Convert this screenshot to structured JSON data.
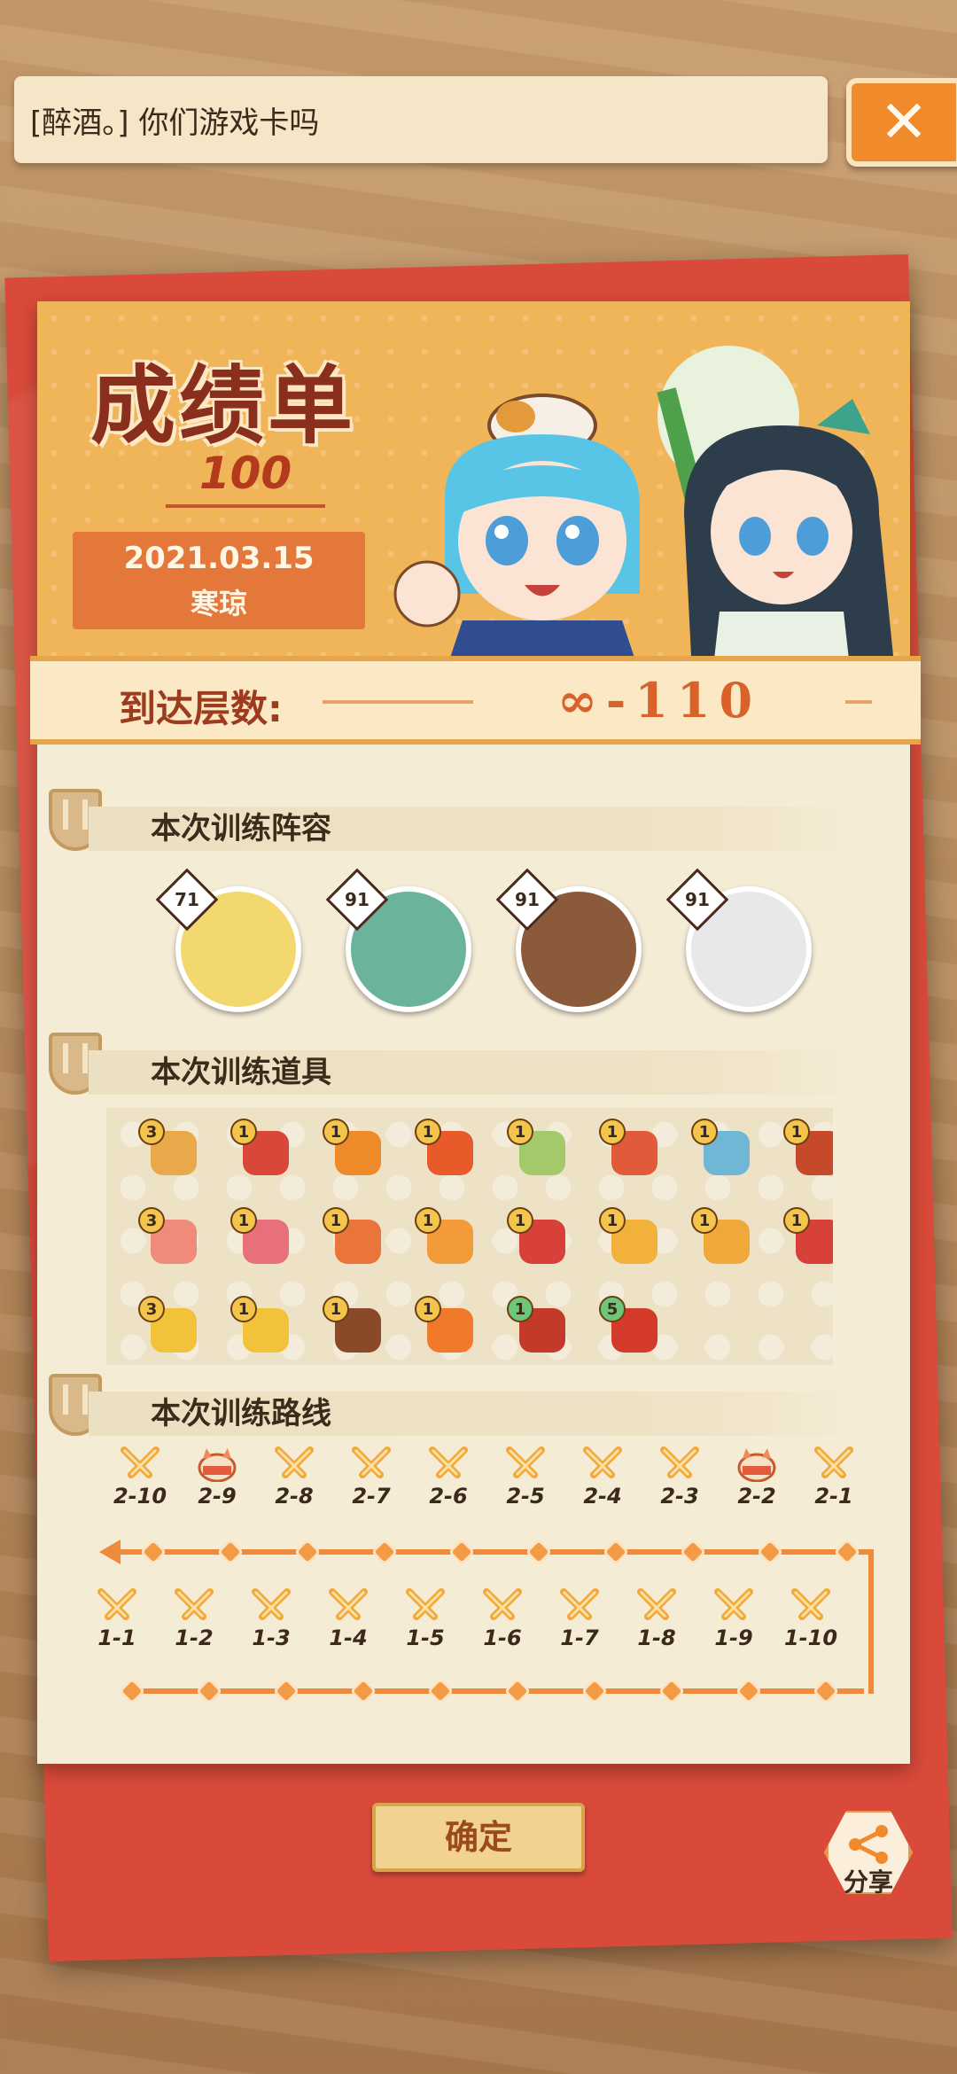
{
  "chat": {
    "message": "[醉酒。] 你们游戏卡吗"
  },
  "close": {
    "icon": "close-icon"
  },
  "report": {
    "title": "成绩单",
    "score": "100",
    "date": "2021.03.15",
    "player": "寒琼"
  },
  "floor": {
    "label": "到达层数:",
    "value": "∞-110"
  },
  "team": {
    "heading": "本次训练阵容",
    "members": [
      {
        "level": "71",
        "color": "#f3d870"
      },
      {
        "level": "91",
        "color": "#6bb39a"
      },
      {
        "level": "91",
        "color": "#8a5a3a"
      },
      {
        "level": "91",
        "color": "#e8e8ea"
      }
    ]
  },
  "items": {
    "heading": "本次训练道具",
    "rows": [
      [
        {
          "count": "3",
          "color": "#e9a84a"
        },
        {
          "count": "1",
          "color": "#d8473a"
        },
        {
          "count": "1",
          "color": "#ef8a2a"
        },
        {
          "count": "1",
          "color": "#e85a2a"
        },
        {
          "count": "1",
          "color": "#a4c96a"
        },
        {
          "count": "1",
          "color": "#e15a3a"
        },
        {
          "count": "1",
          "color": "#6fb7d4"
        },
        {
          "count": "1",
          "color": "#c64a2a"
        }
      ],
      [
        {
          "count": "3",
          "color": "#f08a7a"
        },
        {
          "count": "1",
          "color": "#e8707a"
        },
        {
          "count": "1",
          "color": "#e9753a"
        },
        {
          "count": "1",
          "color": "#f39a3a"
        },
        {
          "count": "1",
          "color": "#d8403a"
        },
        {
          "count": "1",
          "color": "#f2b13a"
        },
        {
          "count": "1",
          "color": "#f0a83a"
        },
        {
          "count": "1",
          "color": "#d8403a"
        }
      ],
      [
        {
          "count": "3",
          "color": "#f2c23a"
        },
        {
          "count": "1",
          "color": "#f2c23a"
        },
        {
          "count": "1",
          "color": "#8a4a2a"
        },
        {
          "count": "1",
          "color": "#f07a2a"
        },
        {
          "count": "1",
          "color": "#c43a2a",
          "green": true
        },
        {
          "count": "5",
          "color": "#d43a2a",
          "green": true
        }
      ]
    ]
  },
  "route": {
    "heading": "本次训练路线",
    "top": [
      "2-10",
      "2-9",
      "2-8",
      "2-7",
      "2-6",
      "2-5",
      "2-4",
      "2-3",
      "2-2",
      "2-1"
    ],
    "top_types": [
      "battle",
      "cat",
      "battle",
      "battle",
      "battle",
      "battle",
      "battle",
      "battle",
      "cat",
      "battle"
    ],
    "bottom": [
      "1-1",
      "1-2",
      "1-3",
      "1-4",
      "1-5",
      "1-6",
      "1-7",
      "1-8",
      "1-9",
      "1-10"
    ]
  },
  "confirm": {
    "label": "确定"
  },
  "share": {
    "label": "分享",
    "icon": "share-icon"
  }
}
